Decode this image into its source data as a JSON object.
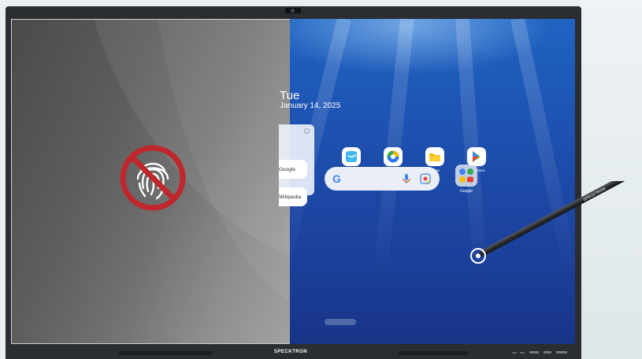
{
  "brand": "SPECKTRON",
  "pen_brand": "SPECKTRON",
  "left_pane": {
    "status_icon": "no-fingerprint-icon"
  },
  "home": {
    "day": "Tue",
    "date": "January 14, 2025",
    "widget": {
      "items": [
        "Google",
        "Wikipedia"
      ]
    },
    "apps": [
      {
        "label": "Note",
        "icon": "note-icon"
      },
      {
        "label": "Browser",
        "icon": "browser-icon"
      },
      {
        "label": "Finder",
        "icon": "folder-icon"
      },
      {
        "label": "Play Store",
        "icon": "play-store-icon"
      }
    ],
    "search_bar": {
      "logo": "G",
      "icons": [
        "mic-icon",
        "lens-icon"
      ]
    },
    "folder": {
      "label": "Google"
    }
  },
  "colors": {
    "wallpaper": "#1e56b6",
    "no_sign": "#c0262d",
    "bezel": "#2a2d31"
  }
}
